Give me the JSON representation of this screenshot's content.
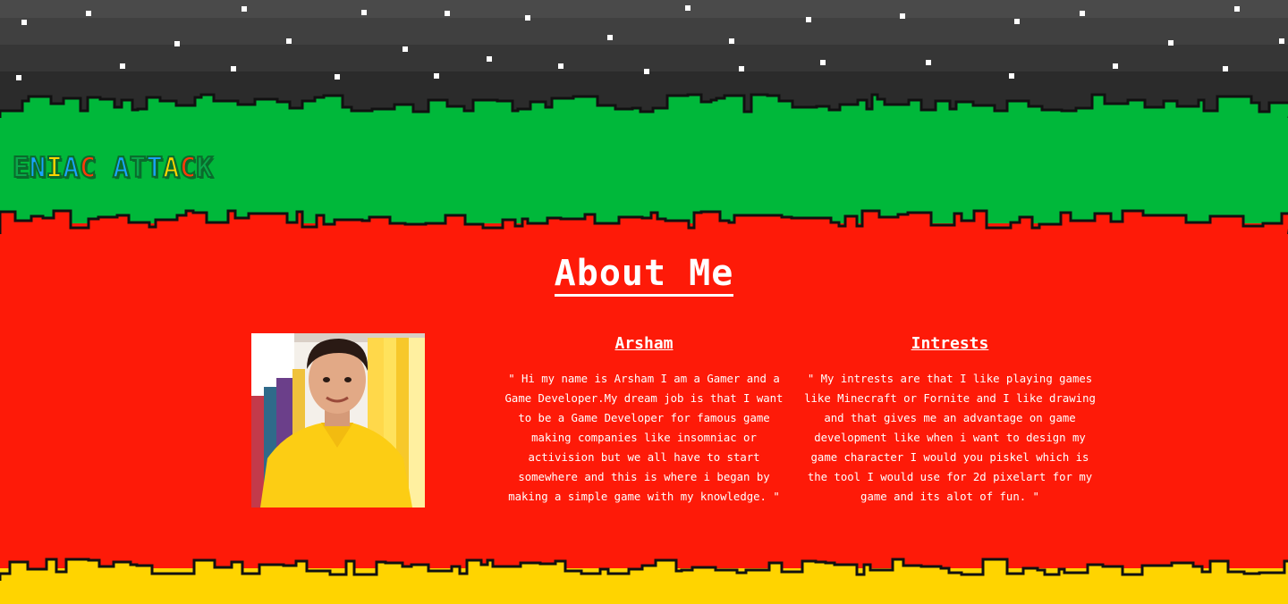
{
  "logo": {
    "letters": [
      {
        "ch": "E",
        "color": "#0aa84a"
      },
      {
        "ch": "N",
        "color": "#1aa3ff"
      },
      {
        "ch": "I",
        "color": "#ffd400"
      },
      {
        "ch": "A",
        "color": "#1aa3ff"
      },
      {
        "ch": "C",
        "color": "#fe3a08"
      },
      {
        "ch": " ",
        "color": "#00b83a"
      },
      {
        "ch": "A",
        "color": "#1aa3ff"
      },
      {
        "ch": "T",
        "color": "#0aa84a"
      },
      {
        "ch": "T",
        "color": "#1aa3ff"
      },
      {
        "ch": "A",
        "color": "#ffd400"
      },
      {
        "ch": "C",
        "color": "#fe3a08"
      },
      {
        "ch": "K",
        "color": "#0aa84a"
      }
    ]
  },
  "about": {
    "title": "About Me",
    "name_heading": "Arsham",
    "bio": "\" Hi my name is Arsham I am a Gamer and a Game Developer.My dream job is that I want to be a Game Developer for famous game making companies like insomniac or activision but we all have to start somewhere and this is where i began by making a simple game with my knowledge. \"",
    "interests_heading": "Intrests",
    "interests": "\" My intrests are that I like playing games like Minecraft or Fornite and I like drawing and that gives me an advantage on game development like when i want to design my game character I would you piskel which is the tool I would use for 2d pixelart for my game and its alot of fun. \""
  },
  "colors": {
    "green": "#00b83a",
    "red": "#fe1a08",
    "yellow": "#ffd400",
    "sky": "#2b2b2b"
  }
}
